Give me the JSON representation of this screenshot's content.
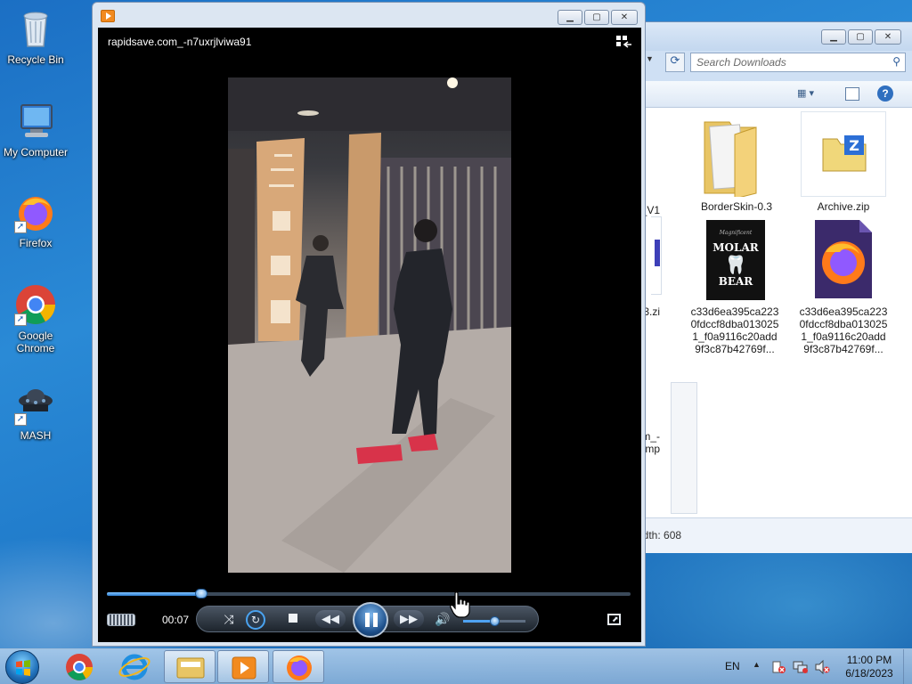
{
  "desktop": {
    "icons": [
      {
        "label": "Recycle Bin"
      },
      {
        "label": "My Computer"
      },
      {
        "label": "Firefox"
      },
      {
        "label": "Google Chrome"
      },
      {
        "label": "MASH"
      }
    ]
  },
  "explorer": {
    "search_placeholder": "Search Downloads",
    "files": [
      {
        "name": "_V1"
      },
      {
        "name": "BorderSkin-0.3"
      },
      {
        "name": "Archive.zip"
      },
      {
        "name": ".3.zi"
      },
      {
        "name": "c33d6ea395ca2230fdccf8dba0130251_f0a9116c20add9f3c87b42769f..."
      },
      {
        "name": "c33d6ea395ca2230fdccf8dba0130251_f0a9116c20add9f3c87b42769f..."
      },
      {
        "name": "m_-\n..mp"
      }
    ],
    "file_thumb_text": {
      "molar": "MOLAR",
      "bear": "BEAR",
      "magnificent": "Magnificent"
    },
    "details_text": "idth: 608"
  },
  "player": {
    "video_title": "rapidsave.com_-n7uxrjlviwa91",
    "time": "00:07",
    "progress": 0.18,
    "volume": 0.5
  },
  "taskbar": {
    "language": "EN",
    "time": "11:00 PM",
    "date": "6/18/2023"
  },
  "colors": {
    "accent": "#1f6fb8",
    "player_bg": "#000000",
    "seek_fill": "#4fa3f3"
  }
}
